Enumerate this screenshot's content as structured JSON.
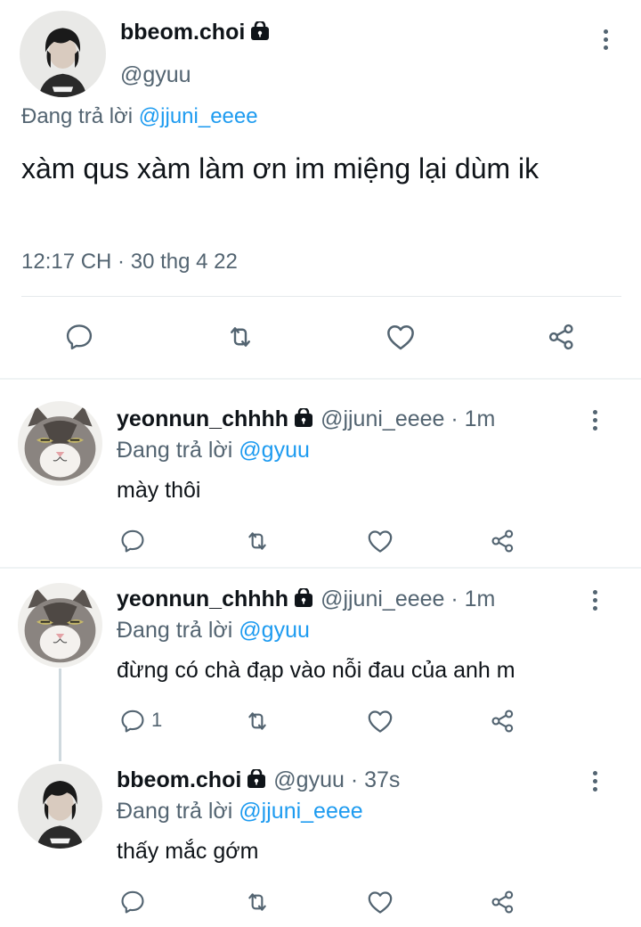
{
  "main_tweet": {
    "name": "bbeom.choi",
    "handle": "@gyuu",
    "replying_prefix": "Đang trả lời",
    "replying_to": "@jjuni_eeee",
    "text": "xàm qus xàm làm ơn im miệng lại dùm ik",
    "timestamp": "12:17 CH · 30 thg 4 22",
    "icons": [
      "comment-icon",
      "retweet-icon",
      "heart-icon",
      "share-icon",
      "more-icon",
      "lock-icon"
    ]
  },
  "replies": [
    {
      "name": "yeonnun_chhhh",
      "handle": "@jjuni_eeee",
      "time": " · 1m",
      "replying_prefix": "Đang trả lời",
      "replying_to": "@gyuu",
      "text": "mày thôi",
      "comment_count": ""
    },
    {
      "name": "yeonnun_chhhh",
      "handle": "@jjuni_eeee",
      "time": " · 1m",
      "replying_prefix": "Đang trả lời",
      "replying_to": "@gyuu",
      "text": "đừng có chà đạp vào nỗi đau của anh m",
      "comment_count": "1"
    },
    {
      "name": "bbeom.choi",
      "handle": "@gyuu",
      "time": " · 37s",
      "replying_prefix": "Đang trả lời",
      "replying_to": "@jjuni_eeee",
      "text": "thấy mắc gớm",
      "comment_count": ""
    }
  ],
  "colors": {
    "text": "#0f1419",
    "secondary": "#536471",
    "accent": "#1d9bf0",
    "divider": "#eff3f4"
  }
}
